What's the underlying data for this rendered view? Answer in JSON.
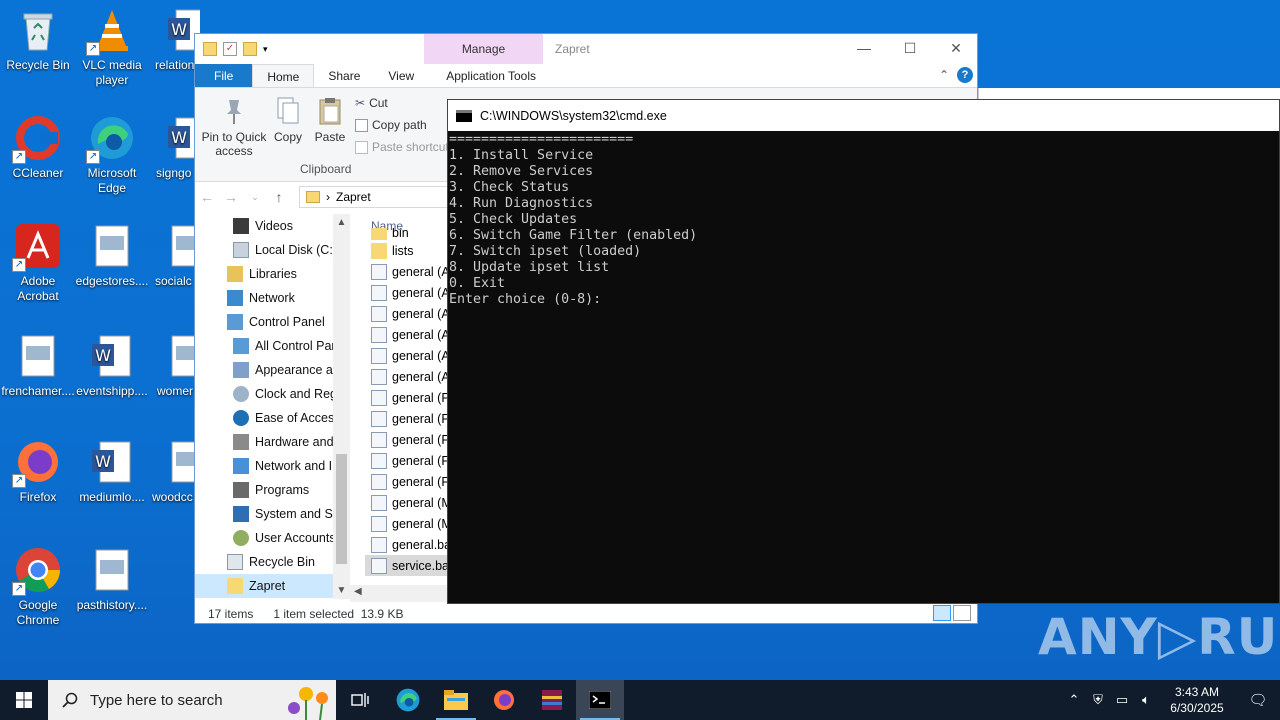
{
  "desktop": {
    "icons": [
      {
        "label": "Recycle Bin",
        "icon": "recycle-bin-icon"
      },
      {
        "label": "VLC media player",
        "icon": "vlc-icon"
      },
      {
        "label": "relation",
        "icon": "word-doc-icon"
      },
      {
        "label": "CCleaner",
        "icon": "ccleaner-icon"
      },
      {
        "label": "Microsoft Edge",
        "icon": "edge-icon"
      },
      {
        "label": "signgo",
        "icon": "word-doc-icon"
      },
      {
        "label": "Adobe Acrobat",
        "icon": "acrobat-icon"
      },
      {
        "label": "edgestores....",
        "icon": "image-file-icon"
      },
      {
        "label": "socialc",
        "icon": "image-file-icon"
      },
      {
        "label": "frenchamer....",
        "icon": "image-file-icon"
      },
      {
        "label": "eventshipp....",
        "icon": "word-doc-icon"
      },
      {
        "label": "womer",
        "icon": "image-file-icon"
      },
      {
        "label": "Firefox",
        "icon": "firefox-icon"
      },
      {
        "label": "mediumlo....",
        "icon": "word-doc-icon"
      },
      {
        "label": "woodcc",
        "icon": "image-file-icon"
      },
      {
        "label": "Google Chrome",
        "icon": "chrome-icon"
      },
      {
        "label": "pasthistory....",
        "icon": "image-file-icon"
      }
    ],
    "watermark": "ANY▷RUN"
  },
  "explorer": {
    "title": "Zapret",
    "manage_tab": "Manage",
    "tabs": {
      "file": "File",
      "home": "Home",
      "share": "Share",
      "view": "View",
      "app_tools": "Application Tools"
    },
    "ribbon": {
      "pin": "Pin to Quick access",
      "copy": "Copy",
      "paste": "Paste",
      "cut": "Cut",
      "copy_path": "Copy path",
      "paste_shortcut": "Paste shortcut",
      "group_clipboard": "Clipboard"
    },
    "address": {
      "path": "Zapret",
      "separator": "›"
    },
    "nav": [
      {
        "label": "Videos"
      },
      {
        "label": "Local Disk (C:)"
      },
      {
        "label": "Libraries"
      },
      {
        "label": "Network"
      },
      {
        "label": "Control Panel"
      },
      {
        "label": "All Control Par"
      },
      {
        "label": "Appearance an"
      },
      {
        "label": "Clock and Regi"
      },
      {
        "label": "Ease of Access"
      },
      {
        "label": "Hardware and"
      },
      {
        "label": "Network and Ir"
      },
      {
        "label": "Programs"
      },
      {
        "label": "System and Sec"
      },
      {
        "label": "User Accounts"
      },
      {
        "label": "Recycle Bin"
      },
      {
        "label": "Zapret"
      }
    ],
    "files_header": "Name",
    "files": [
      {
        "name": "bin"
      },
      {
        "name": "lists"
      },
      {
        "name": "general (A"
      },
      {
        "name": "general (A"
      },
      {
        "name": "general (A"
      },
      {
        "name": "general (A"
      },
      {
        "name": "general (A"
      },
      {
        "name": "general (A"
      },
      {
        "name": "general (FA"
      },
      {
        "name": "general (FA"
      },
      {
        "name": "general (FA"
      },
      {
        "name": "general (FA"
      },
      {
        "name": "general (FA"
      },
      {
        "name": "general (M"
      },
      {
        "name": "general (M"
      },
      {
        "name": "general.ba"
      },
      {
        "name": "service.bat"
      }
    ],
    "status": {
      "items": "17 items",
      "selected": "1 item selected",
      "size": "13.9 KB"
    }
  },
  "cmd": {
    "title": "C:\\WINDOWS\\system32\\cmd.exe",
    "lines": [
      "=======================",
      "1. Install Service",
      "2. Remove Services",
      "3. Check Status",
      "4. Run Diagnostics",
      "5. Check Updates",
      "6. Switch Game Filter (enabled)",
      "7. Switch ipset (loaded)",
      "8. Update ipset list",
      "0. Exit",
      "Enter choice (0-8):"
    ]
  },
  "taskbar": {
    "search_placeholder": "Type here to search",
    "time": "3:43 AM",
    "date": "6/30/2025"
  },
  "colors": {
    "desktop": "#0b6fd0",
    "taskbar": "#101c2c",
    "file_tab": "#1979ca",
    "manage_tab": "#f2d6f6"
  }
}
